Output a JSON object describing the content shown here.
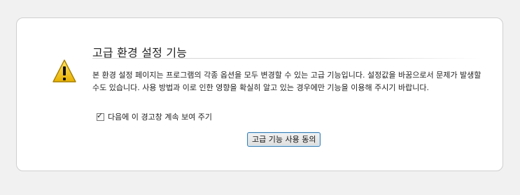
{
  "warning": {
    "title": "고급 환경 설정 기능",
    "message": "본 환경 설정 페이지는 프로그램의 각종 옵션을 모두 변경할 수 있는 고급 기능입니다. 설정값을 바꿈으로서 문제가 발생할 수도 있습니다. 사용 방법과 이로 인한 영향을 확실히 알고 있는 경우에만 기능을 이용해 주시기 바랍니다.",
    "checkbox_label": "다음에 이 경고창 계속 보여 주기",
    "checkbox_checked": true,
    "button_label": "고급 기능 사용 동의",
    "icon": "warning-triangle-icon"
  },
  "colors": {
    "icon_fill": "#f0c419",
    "button_border": "#3c7fb1"
  }
}
